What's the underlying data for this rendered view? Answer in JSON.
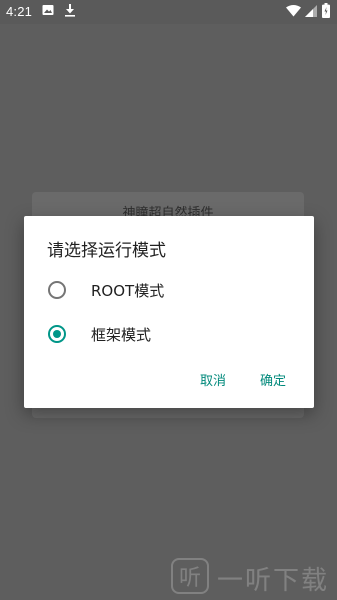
{
  "status_bar": {
    "time": "4:21",
    "icons": [
      "image-icon",
      "download-icon",
      "wifi-icon",
      "signal-icon",
      "battery-icon"
    ]
  },
  "background_app": {
    "title": "神瞳超自然插件"
  },
  "dialog": {
    "title": "请选择运行模式",
    "options": [
      {
        "label": "ROOT模式",
        "checked": false
      },
      {
        "label": "框架模式",
        "checked": true
      }
    ],
    "cancel_label": "取消",
    "confirm_label": "确定",
    "accent_color": "#009688"
  },
  "watermark": {
    "text": "一听下载",
    "logo_text": "听"
  }
}
